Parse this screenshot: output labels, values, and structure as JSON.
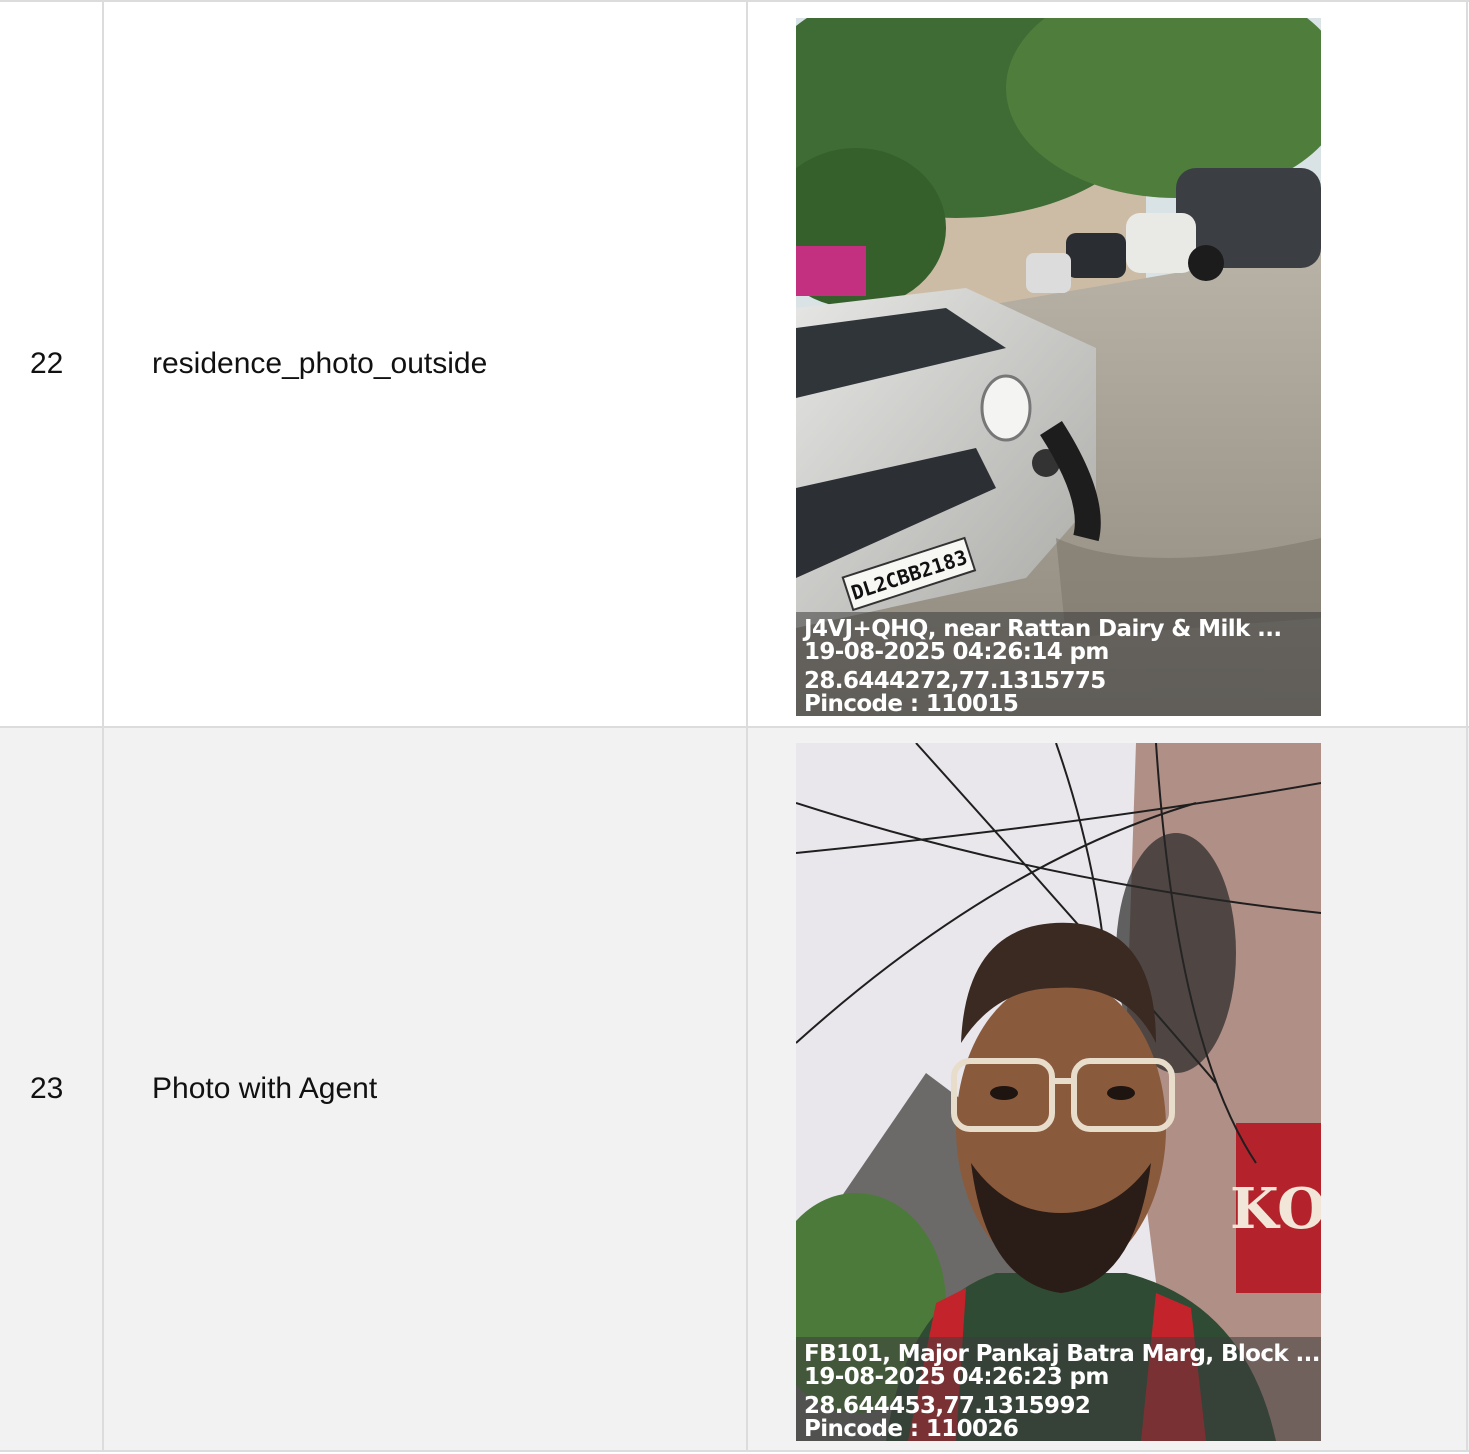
{
  "rows": [
    {
      "number": "22",
      "label": "residence_photo_outside",
      "photo": {
        "address": "J4VJ+QHQ, near Rattan Dairy & Milk ...",
        "datetime": "19-08-2025 04:26:14 pm",
        "coordinates": "28.6444272,77.1315775",
        "pincode": "Pincode : 110015",
        "plate": "DL2CBB2183"
      }
    },
    {
      "number": "23",
      "label": "Photo with Agent",
      "photo": {
        "address": "FB101, Major Pankaj Batra Marg, Block ...",
        "datetime": "19-08-2025 04:26:23 pm",
        "coordinates": "28.644453,77.1315992",
        "pincode": "Pincode : 110026",
        "sign_text": "KO"
      }
    }
  ]
}
